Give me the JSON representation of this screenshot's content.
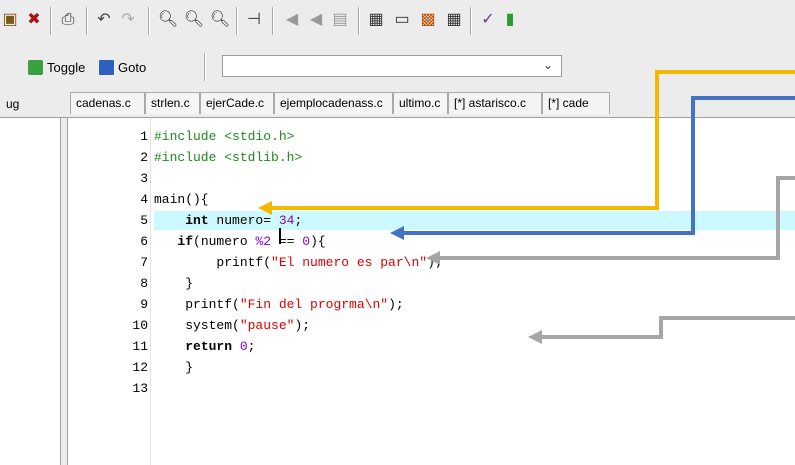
{
  "toolbar": {
    "icons": [
      "project-icon",
      "close-project-icon",
      "print-icon",
      "undo-icon",
      "redo-icon",
      "find-icon",
      "find-next-icon",
      "replace-icon",
      "goto-line-icon",
      "indent-icon",
      "unindent-icon",
      "compile-icon",
      "debug-layout-icon",
      "window-icon",
      "color-icon",
      "grid-icon",
      "check-icon",
      "chart-icon"
    ]
  },
  "toolbar2": {
    "toggle_label": "Toggle",
    "goto_label": "Goto",
    "combo_value": ""
  },
  "left_tab": {
    "label": "ug"
  },
  "tabs": [
    {
      "label": "cadenas.c"
    },
    {
      "label": "strlen.c"
    },
    {
      "label": "ejerCade.c"
    },
    {
      "label": "ejemplocadenass.c"
    },
    {
      "label": "ultimo.c"
    },
    {
      "label": "[*] astarisco.c"
    },
    {
      "label": "[*] cade"
    }
  ],
  "editor": {
    "line_numbers": [
      "1",
      "2",
      "3",
      "4",
      "5",
      "6",
      "7",
      "8",
      "9",
      "10",
      "11",
      "12",
      "13"
    ],
    "lines": [
      {
        "parts": [
          {
            "cls": "pp",
            "text": "#include <stdio.h>"
          }
        ]
      },
      {
        "parts": [
          {
            "cls": "pp",
            "text": "#include <stdlib.h>"
          }
        ]
      },
      {
        "parts": [
          {
            "cls": "plain",
            "text": ""
          }
        ]
      },
      {
        "parts": [
          {
            "cls": "plain",
            "text": "main(){"
          }
        ]
      },
      {
        "parts": [
          {
            "cls": "plain",
            "text": "    "
          },
          {
            "cls": "kw",
            "text": "int"
          },
          {
            "cls": "plain",
            "text": " numero= "
          },
          {
            "cls": "num",
            "text": "34"
          },
          {
            "cls": "plain",
            "text": ";"
          }
        ]
      },
      {
        "parts": [
          {
            "cls": "plain",
            "text": "   "
          },
          {
            "cls": "kw",
            "text": "if"
          },
          {
            "cls": "plain",
            "text": "(numero "
          },
          {
            "cls": "num",
            "text": "%2"
          },
          {
            "cls": "plain",
            "text": " == "
          },
          {
            "cls": "num",
            "text": "0"
          },
          {
            "cls": "plain",
            "text": "){"
          }
        ]
      },
      {
        "parts": [
          {
            "cls": "plain",
            "text": "        printf("
          },
          {
            "cls": "str",
            "text": "\"El numero es par\\n\""
          },
          {
            "cls": "plain",
            "text": ");"
          }
        ]
      },
      {
        "parts": [
          {
            "cls": "plain",
            "text": "    }"
          }
        ]
      },
      {
        "parts": [
          {
            "cls": "plain",
            "text": "    printf("
          },
          {
            "cls": "str",
            "text": "\"Fin del progrma\\n\""
          },
          {
            "cls": "plain",
            "text": ");"
          }
        ]
      },
      {
        "parts": [
          {
            "cls": "plain",
            "text": "    system("
          },
          {
            "cls": "str",
            "text": "\"pause\""
          },
          {
            "cls": "plain",
            "text": ");"
          }
        ]
      },
      {
        "parts": [
          {
            "cls": "plain",
            "text": "    "
          },
          {
            "cls": "kw",
            "text": "return"
          },
          {
            "cls": "plain",
            "text": " "
          },
          {
            "cls": "num",
            "text": "0"
          },
          {
            "cls": "plain",
            "text": ";"
          }
        ]
      },
      {
        "parts": [
          {
            "cls": "plain",
            "text": "    }"
          }
        ]
      },
      {
        "parts": [
          {
            "cls": "plain",
            "text": ""
          }
        ]
      }
    ],
    "current_line": 5
  },
  "annotation_colors": {
    "yellow": "#f5b800",
    "blue": "#4472c4",
    "gray": "#a6a6a6"
  }
}
